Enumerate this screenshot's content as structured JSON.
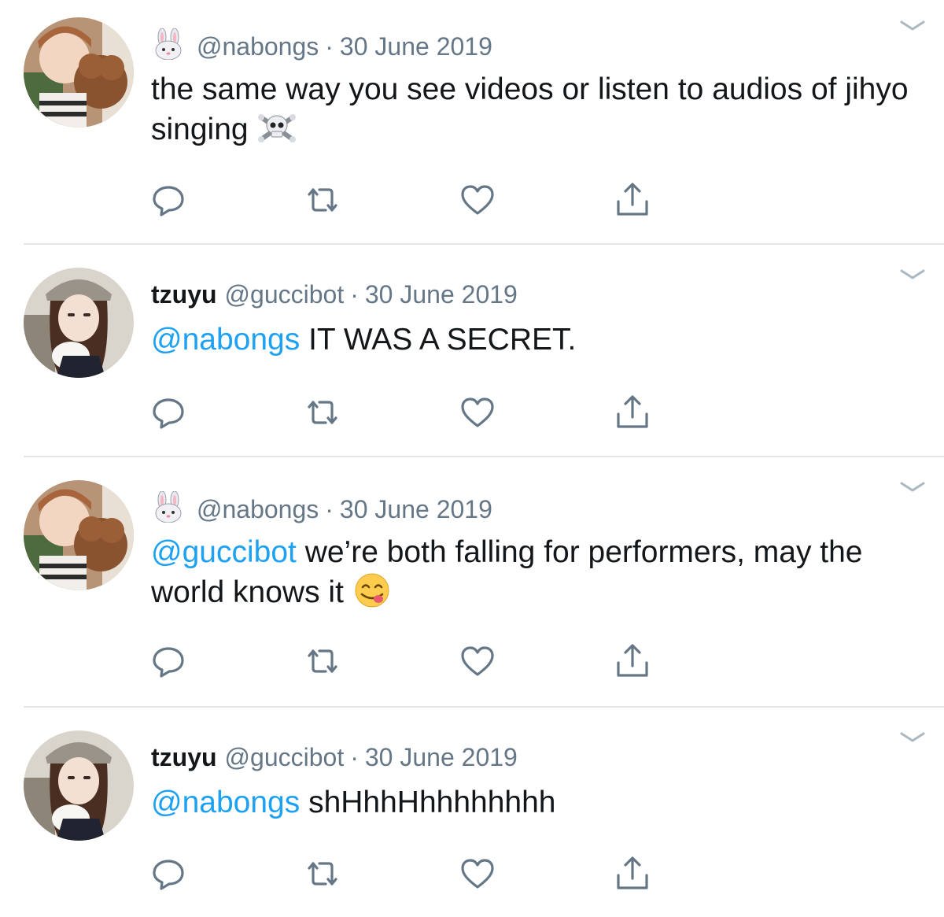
{
  "tweets": [
    {
      "display_name": "",
      "handle": "@nabongs",
      "date": "30 June 2019",
      "name_emoji": "rabbit-face",
      "mention": "",
      "text": "the same way you see videos or listen to audios of jihyo singing",
      "trailing_emoji": "skull-and-crossbones"
    },
    {
      "display_name": "tzuyu",
      "handle": "@guccibot",
      "date": "30 June 2019",
      "mention": "@nabongs",
      "text": " IT WAS A SECRET."
    },
    {
      "display_name": "",
      "handle": "@nabongs",
      "date": "30 June 2019",
      "name_emoji": "rabbit-face",
      "mention": "@guccibot",
      "text": " we’re both falling for performers, may the world knows it",
      "trailing_emoji": "face-savoring-food"
    },
    {
      "display_name": "tzuyu",
      "handle": "@guccibot",
      "date": "30 June 2019",
      "mention": "@nabongs",
      "text": " shHhhHhhhhhhhh"
    }
  ],
  "separator": "·",
  "actions": [
    "reply-icon",
    "retweet-icon",
    "like-icon",
    "share-icon"
  ],
  "colors": {
    "mention": "#1da1f2",
    "meta": "#657786",
    "text": "#14171a",
    "icon": "#657786",
    "divider": "#e3e6e9"
  }
}
